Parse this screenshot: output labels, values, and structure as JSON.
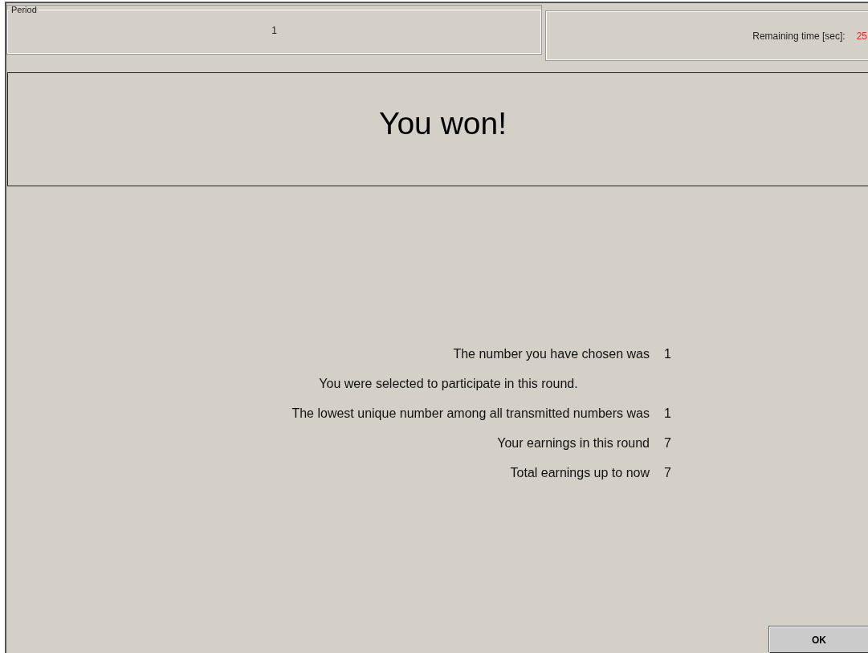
{
  "period": {
    "label": "Period",
    "value": "1"
  },
  "timer": {
    "label": "Remaining time [sec]:",
    "value": "25"
  },
  "headline": "You won!",
  "results": [
    {
      "kind": "pair",
      "label": "The number you have chosen was",
      "value": "1"
    },
    {
      "kind": "note",
      "label": "You were selected to participate in this round."
    },
    {
      "kind": "pair",
      "label": "The lowest unique number among all transmitted numbers was",
      "value": "1"
    },
    {
      "kind": "pair",
      "label": "Your earnings in this round",
      "value": "7"
    },
    {
      "kind": "pair",
      "label": "Total earnings up to now",
      "value": "7"
    }
  ],
  "button": "OK"
}
